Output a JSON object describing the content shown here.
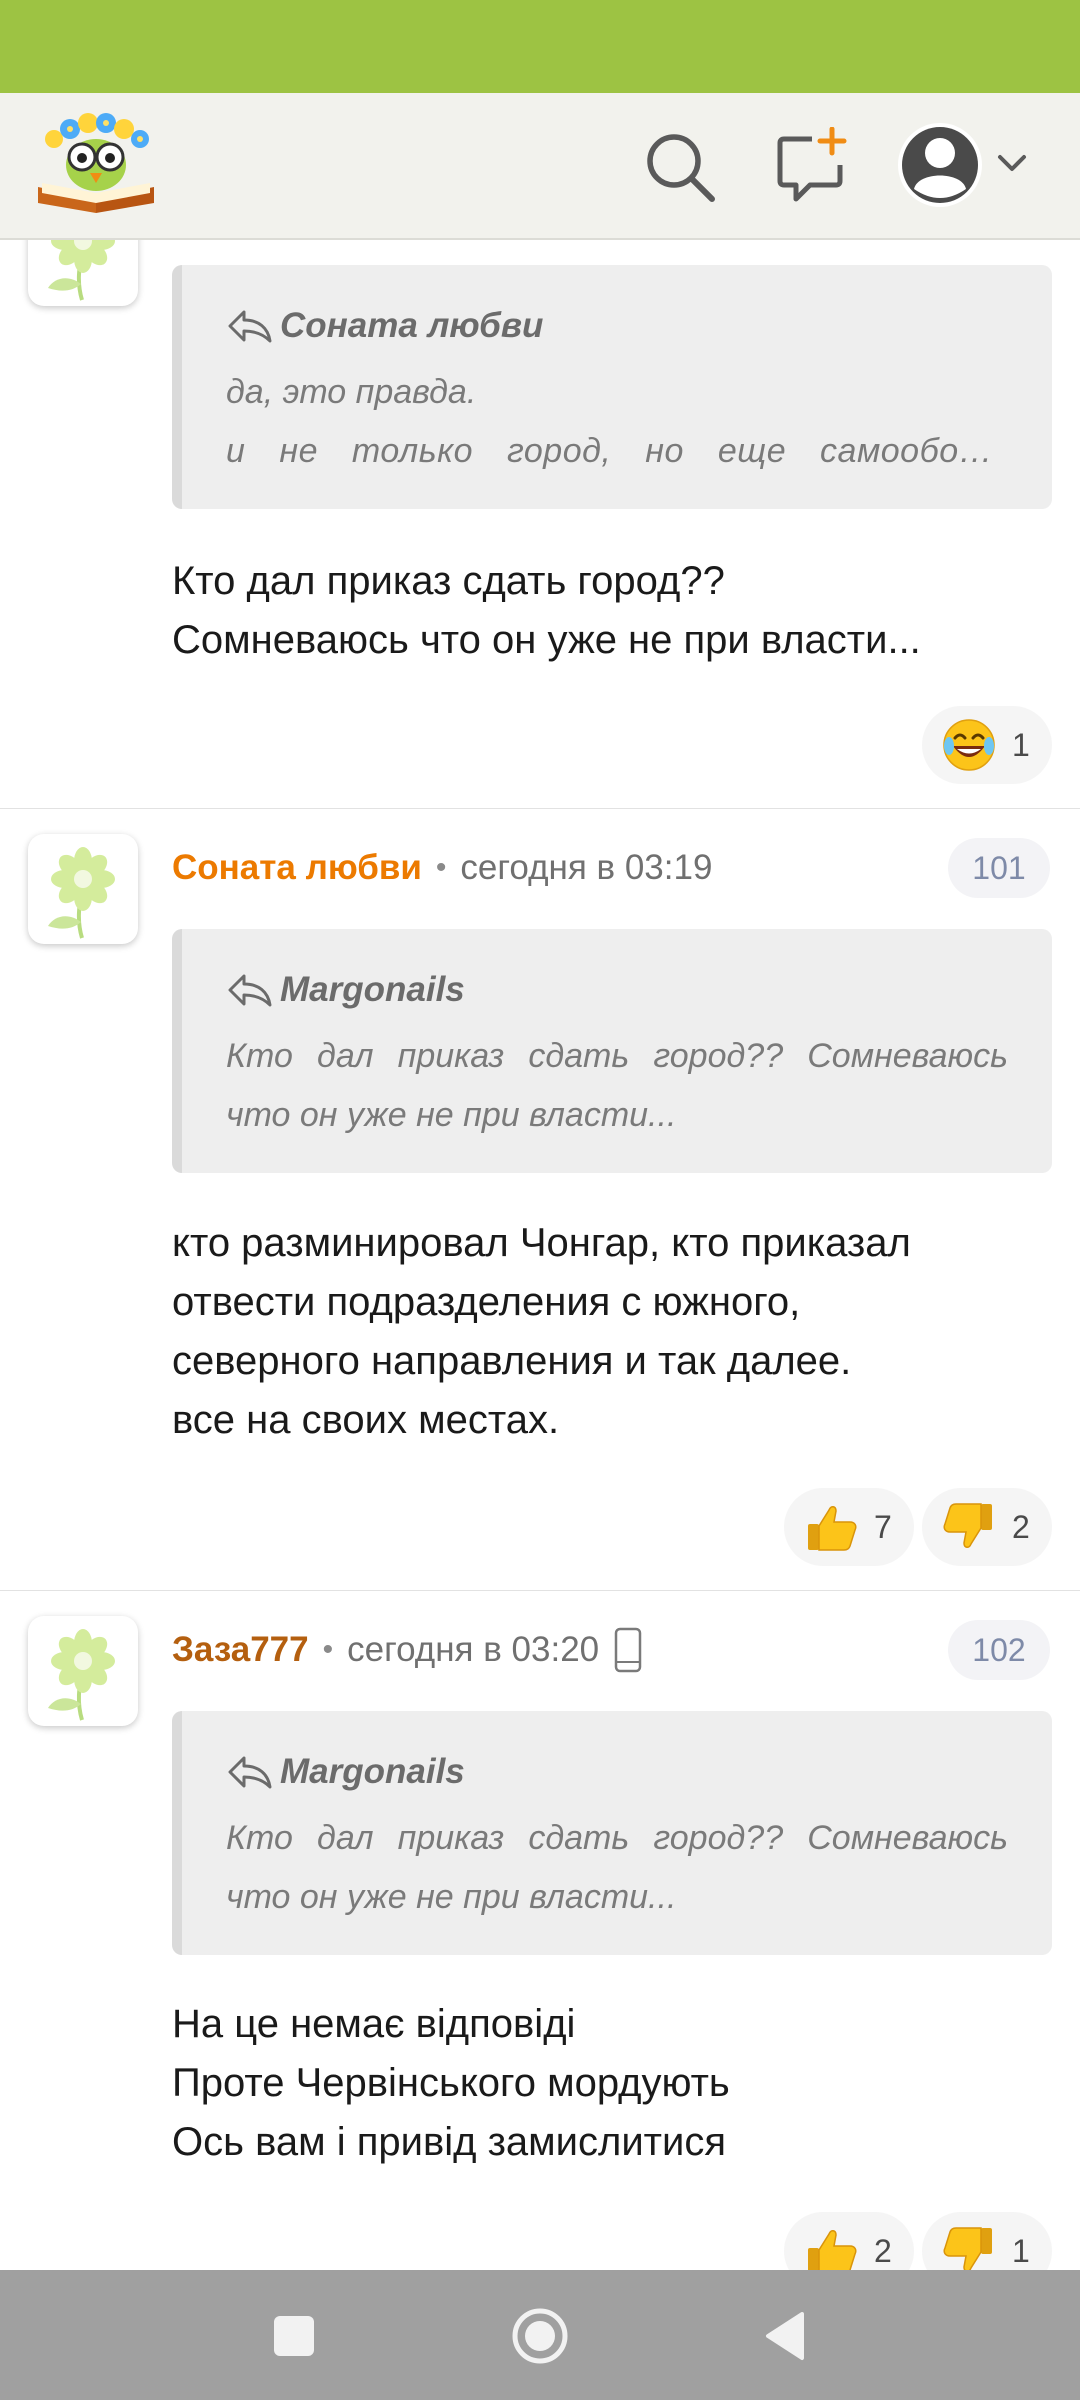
{
  "colors": {
    "status_bar": "#9dc343",
    "header_bg": "#f2f2ed",
    "author_orange": "#ec7a00",
    "author_brown": "#b45f0f",
    "badge_text": "#7e8aa8",
    "nav_bar": "#a0a0a0"
  },
  "header": {
    "logo": "site-logo-owl-book",
    "icons": [
      "search-icon",
      "new-post-icon",
      "user-avatar-icon",
      "chevron-down-icon"
    ]
  },
  "comments": [
    {
      "avatar": "flower-avatar",
      "quote": {
        "author": "Соната любви",
        "line1": "да, это правда.",
        "line2": "и не только город, но еще самооборо..."
      },
      "body": [
        "Кто дал приказ сдать город??",
        "Сомневаюсь что он уже не при власти..."
      ],
      "reactions": [
        {
          "icon": "laughing-emoji-icon",
          "count": "1"
        }
      ]
    },
    {
      "avatar": "flower-avatar",
      "author": "Соната любви",
      "separator": "•",
      "time": "сегодня в 03:19",
      "number": "101",
      "quote": {
        "author": "Margonails",
        "text": "Кто дал приказ сдать город?? Сомневаюсь что он уже не при власти..."
      },
      "body": [
        "кто разминировал Чонгар, кто приказал",
        "отвести подразделения с южного,",
        "северного направления и так далее.",
        "все на своих местах."
      ],
      "reactions": [
        {
          "icon": "thumbs-up-icon",
          "count": "7"
        },
        {
          "icon": "thumbs-down-icon",
          "count": "2"
        }
      ]
    },
    {
      "avatar": "flower-avatar",
      "author": "Заза777",
      "separator": "•",
      "time": "сегодня в 03:20",
      "device": "mobile-device-icon",
      "number": "102",
      "quote": {
        "author": "Margonails",
        "text": "Кто дал приказ сдать город?? Сомневаюсь что он уже не при власти..."
      },
      "body": [
        "На це немає відповіді",
        "Проте Червінського мордують",
        "Ось вам і привід замислитися"
      ],
      "reactions": [
        {
          "icon": "thumbs-up-icon",
          "count": "2"
        },
        {
          "icon": "thumbs-down-icon",
          "count": "1"
        }
      ]
    }
  ],
  "nav": {
    "icons": [
      "recent-apps-icon",
      "home-icon",
      "back-icon"
    ]
  }
}
